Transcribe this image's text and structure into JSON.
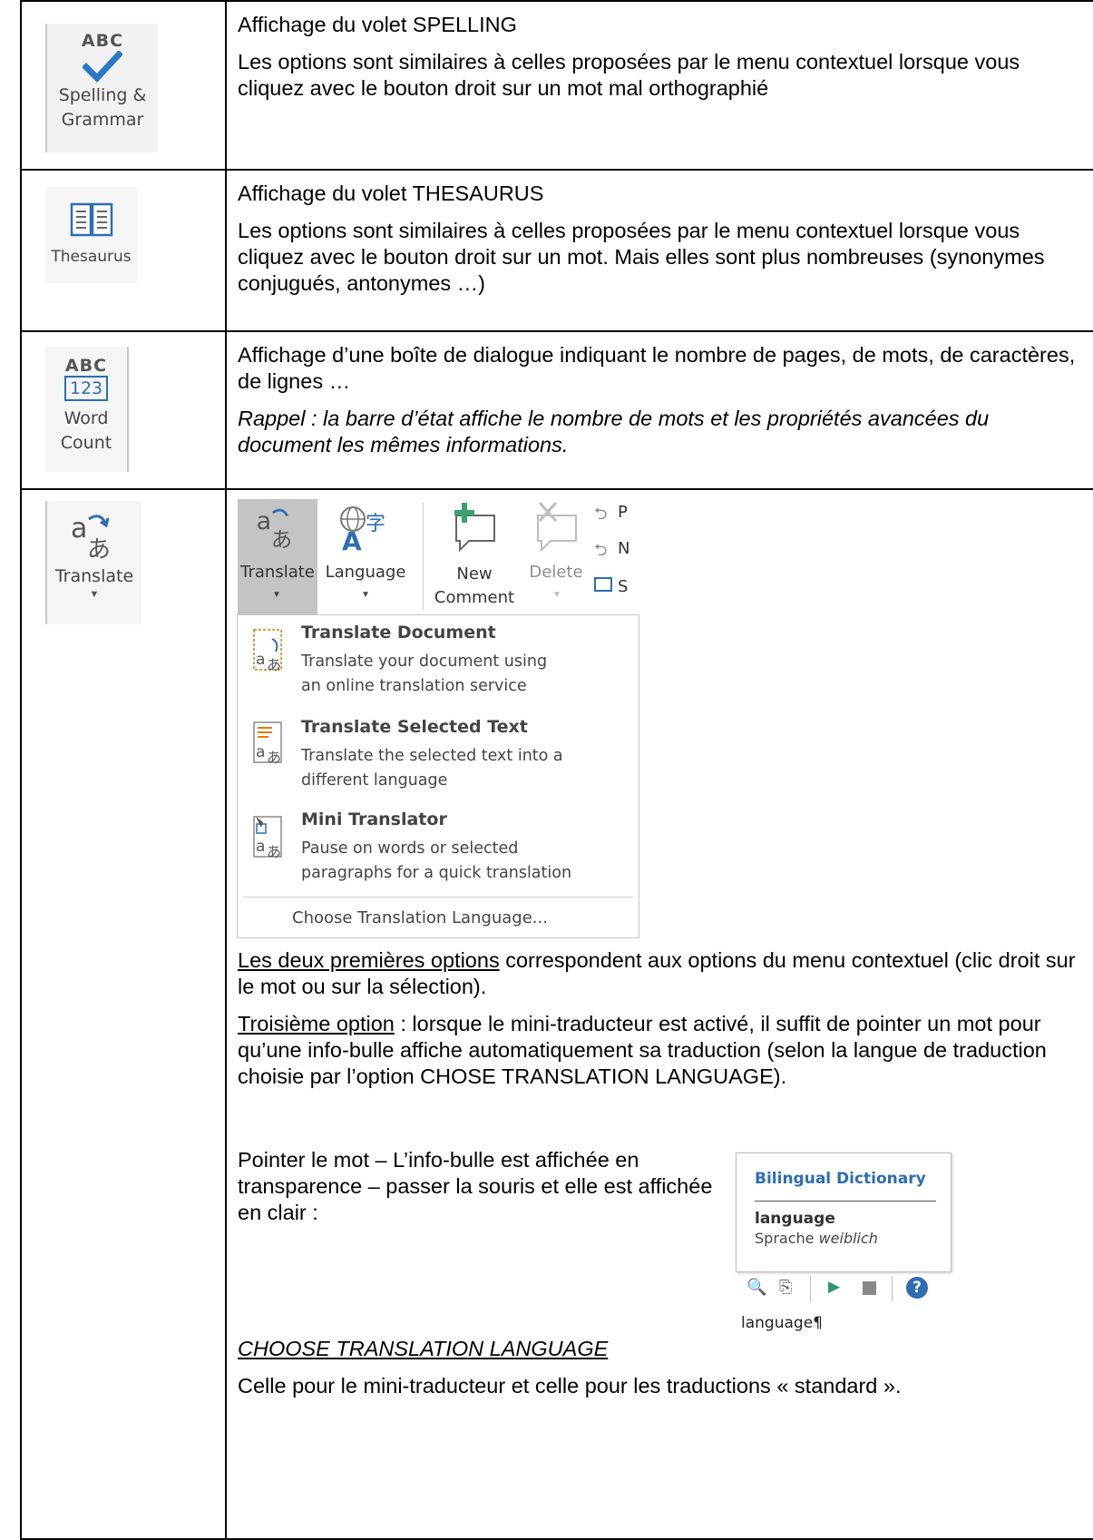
{
  "rows": [
    {
      "icon": {
        "name": "spelling-grammar",
        "abc": "ABC",
        "label_line1": "Spelling &",
        "label_line2": "Grammar"
      },
      "title": "Affichage du volet SPELLING",
      "text": "Les options sont similaires à celles proposées par le menu contextuel lorsque vous cliquez avec le bouton droit sur un mot mal orthographié"
    },
    {
      "icon": {
        "name": "thesaurus",
        "label": "Thesaurus"
      },
      "title": "Affichage du volet THESAURUS",
      "text": "Les options sont similaires à celles proposées par le menu contextuel lorsque vous cliquez avec le bouton droit sur un mot. Mais elles sont plus nombreuses (synonymes conjugués, antonymes …)"
    },
    {
      "icon": {
        "name": "word-count",
        "abc": "ABC",
        "num": "123",
        "label_line1": "Word",
        "label_line2": "Count"
      },
      "title": "Affichage d’une boîte de dialogue indiquant le nombre de pages, de mots, de caractères, de lignes …",
      "text": "Rappel : la barre d’état affiche le nombre de mots et les propriétés avancées du document les mêmes informations."
    },
    {
      "icon": {
        "name": "translate",
        "label": "Translate",
        "glyph": "aあ"
      },
      "ribbon": {
        "translate": "Translate",
        "language": "Language",
        "new_line1": "New",
        "new_line2": "Comment",
        "delete": "Delete",
        "prev_partial": "P",
        "next_partial": "N",
        "show_partial": "S"
      },
      "menu": {
        "items": [
          {
            "title": "Translate Document",
            "desc1": "Translate your document using",
            "desc2": "an online translation service"
          },
          {
            "title": "Translate Selected Text",
            "desc1": "Translate the selected text into a",
            "desc2": "different language"
          },
          {
            "title": "Mini Translator",
            "desc1": "Pause on words or selected",
            "desc2": "paragraphs for a quick translation"
          }
        ],
        "footer": "Choose Translation Language..."
      },
      "p1_underlined": "Les deux premières options",
      "p1_rest": " correspondent aux options du menu contextuel (clic droit sur le mot ou sur la sélection).",
      "p2_underlined": "Troisième option",
      "p2_rest": " : lorsque le mini-traducteur est activé, il suffit de pointer un mot pour qu’une info-bulle affiche automatiquement sa traduction (selon la langue de traduction choisie par l’option CHOSE TRANSLATION LANGUAGE).",
      "p3": "Pointer le mot – L’info-bulle est affichée en transparence – passer la souris et elle est affichée en clair :",
      "tooltip": {
        "header": "Bilingual Dictionary",
        "word": "language",
        "translation": "Sprache",
        "gender": "weiblich",
        "below": "language¶"
      },
      "heading": "CHOOSE TRANSLATION LANGUAGE",
      "last": "Celle pour le mini-traducteur et celle pour les traductions « standard »."
    }
  ],
  "colors": {
    "accent_blue": "#2e6db4",
    "check_blue": "#2b79c2",
    "menu_text": "#444444",
    "border": "#000000"
  }
}
